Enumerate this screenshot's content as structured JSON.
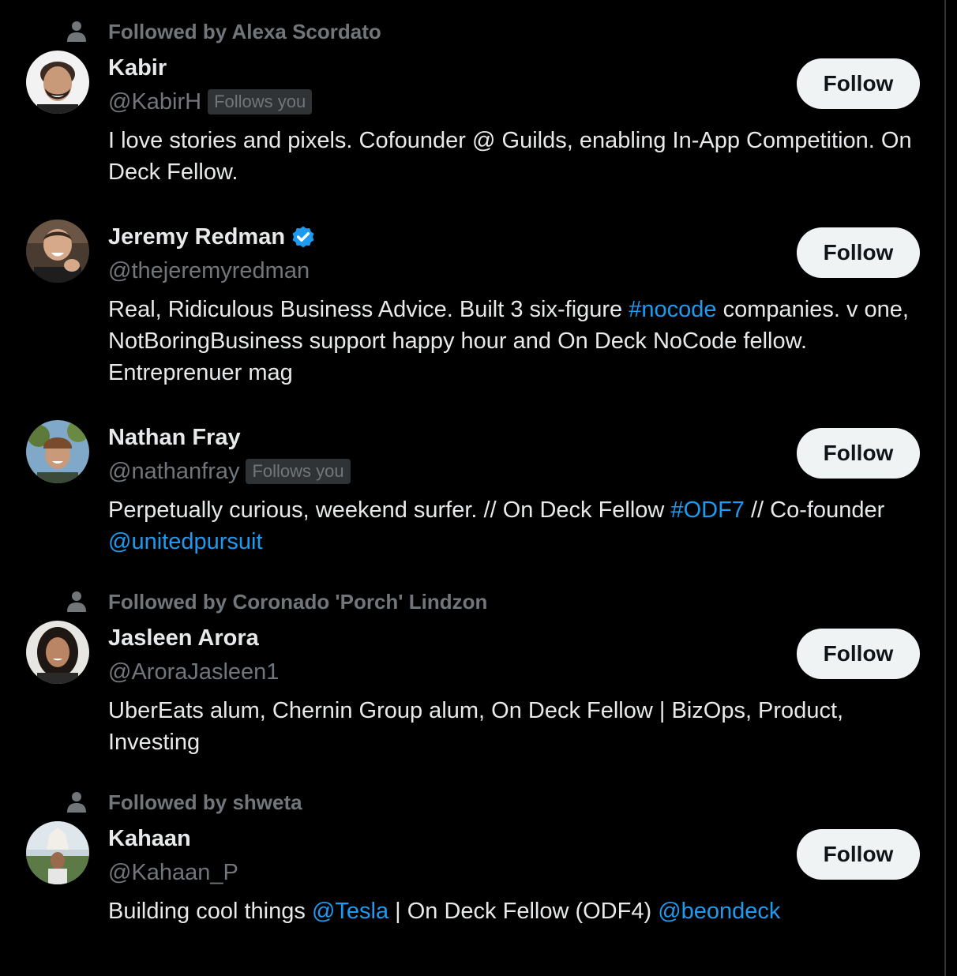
{
  "users": [
    {
      "social_context": "Followed by Alexa Scordato",
      "name": "Kabir",
      "handle": "@KabirH",
      "follows_you": "Follows you",
      "verified": false,
      "bio": [
        {
          "text": "I love stories and pixels. Cofounder @ Guilds, enabling In-App Competition. On Deck Fellow.",
          "link": false
        }
      ],
      "follow_label": "Follow"
    },
    {
      "social_context": "",
      "name": "Jeremy Redman",
      "handle": "@thejeremyredman",
      "follows_you": "",
      "verified": true,
      "bio": [
        {
          "text": "Real, Ridiculous Business Advice. Built 3 six-figure ",
          "link": false
        },
        {
          "text": "#nocode",
          "link": true
        },
        {
          "text": " companies. v one, NotBoringBusiness support happy hour and On Deck NoCode fellow. Entreprenuer mag",
          "link": false
        }
      ],
      "follow_label": "Follow"
    },
    {
      "social_context": "",
      "name": "Nathan Fray",
      "handle": "@nathanfray",
      "follows_you": "Follows you",
      "verified": false,
      "bio": [
        {
          "text": "Perpetually curious, weekend surfer. // On Deck Fellow ",
          "link": false
        },
        {
          "text": "#ODF7",
          "link": true
        },
        {
          "text": " // Co-founder ",
          "link": false
        },
        {
          "text": "@unitedpursuit",
          "link": true
        }
      ],
      "follow_label": "Follow"
    },
    {
      "social_context": "Followed by Coronado 'Porch' Lindzon",
      "name": "Jasleen Arora",
      "handle": "@AroraJasleen1",
      "follows_you": "",
      "verified": false,
      "bio": [
        {
          "text": "UberEats alum, Chernin Group alum, On Deck Fellow | BizOps, Product, Investing",
          "link": false
        }
      ],
      "follow_label": "Follow"
    },
    {
      "social_context": "Followed by shweta",
      "name": "Kahaan",
      "handle": "@Kahaan_P",
      "follows_you": "",
      "verified": false,
      "bio": [
        {
          "text": "Building cool things ",
          "link": false
        },
        {
          "text": "@Tesla",
          "link": true
        },
        {
          "text": " | On Deck Fellow (ODF4) ",
          "link": false
        },
        {
          "text": "@beondeck",
          "link": true
        }
      ],
      "follow_label": "Follow"
    }
  ],
  "icons": {
    "social_context": "person-icon",
    "verified": "verified-badge-icon"
  },
  "colors": {
    "background": "#000000",
    "primary_text": "#e7e9ea",
    "secondary_text": "#71767b",
    "link": "#1d9bf0",
    "follow_button_bg": "#eff3f4",
    "follow_button_text": "#0f1419",
    "badge_bg": "#2f3336",
    "verified": "#1d9bf0"
  }
}
